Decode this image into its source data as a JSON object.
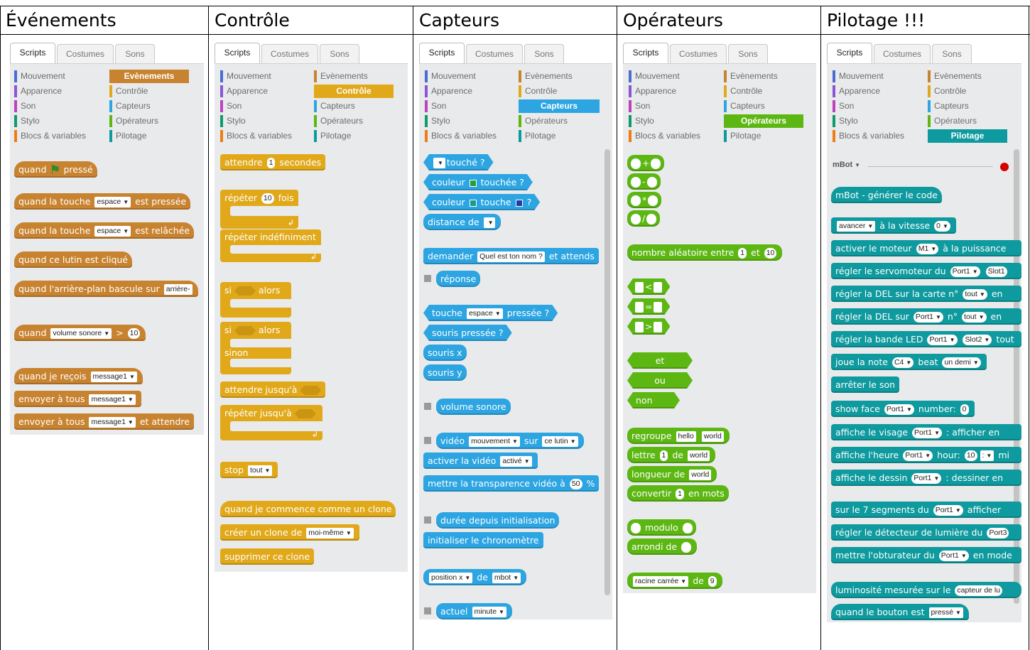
{
  "columns": [
    {
      "title": "Événements"
    },
    {
      "title": "Contrôle"
    },
    {
      "title": "Capteurs"
    },
    {
      "title": "Opérateurs"
    },
    {
      "title": "Pilotage !!!"
    }
  ],
  "tabs": [
    "Scripts",
    "Costumes",
    "Sons"
  ],
  "categories_left": [
    "Mouvement",
    "Apparence",
    "Son",
    "Stylo",
    "Blocs & variables"
  ],
  "categories_right": [
    "Evènements",
    "Contrôle",
    "Capteurs",
    "Opérateurs",
    "Pilotage"
  ],
  "colors": {
    "mouvement": "#4a6cd4",
    "apparence": "#8a55d7",
    "son": "#bb42c3",
    "stylo": "#0e9a6c",
    "blocs": "#ee7d16",
    "evenements": "#c88330",
    "controle": "#e1a91a",
    "capteurs": "#2ca5e2",
    "operateurs": "#5cb712",
    "pilotage": "#0e9a9e"
  },
  "events": {
    "b1a": "quand",
    "b1b": "pressé",
    "b2a": "quand la touche",
    "b2in": "espace",
    "b2b": "est pressée",
    "b3a": "quand la touche",
    "b3in": "espace",
    "b3b": "est relâchée",
    "b4": "quand ce lutin est cliqué",
    "b5a": "quand l'arrière-plan bascule sur",
    "b5in": "arrière-",
    "b6a": "quand",
    "b6in": "volume sonore",
    "b6b": ">",
    "b6v": "10",
    "b7a": "quand je reçois",
    "b7in": "message1",
    "b8a": "envoyer à tous",
    "b8in": "message1",
    "b9a": "envoyer à tous",
    "b9in": "message1",
    "b9b": "et attendre"
  },
  "control": {
    "b1a": "attendre",
    "b1v": "1",
    "b1b": "secondes",
    "b2a": "répéter",
    "b2v": "10",
    "b2b": "fois",
    "b3": "répéter indéfiniment",
    "b4a": "si",
    "b4b": "alors",
    "b5a": "si",
    "b5b": "alors",
    "b5c": "sinon",
    "b6": "attendre jusqu'à",
    "b7": "répéter jusqu'à",
    "b8a": "stop",
    "b8in": "tout",
    "b9": "quand je commence comme un clone",
    "b10a": "créer un clone de",
    "b10in": "moi-même",
    "b11": "supprimer ce clone"
  },
  "sensing": {
    "b1": "touché ?",
    "b2a": "couleur",
    "b2b": "touchée ?",
    "b3a": "couleur",
    "b3b": "touche",
    "b3c": "?",
    "b4": "distance de",
    "b5a": "demander",
    "b5in": "Quel est ton nom ?",
    "b5b": "et attends",
    "b6": "réponse",
    "b7a": "touche",
    "b7in": "espace",
    "b7b": "pressée ?",
    "b8": "souris pressée ?",
    "b9": "souris x",
    "b10": "souris y",
    "b11": "volume sonore",
    "b12a": "vidéo",
    "b12in": "mouvement",
    "b12b": "sur",
    "b12in2": "ce lutin",
    "b13a": "activer la vidéo",
    "b13in": "activé",
    "b14a": "mettre la transparence vidéo à",
    "b14v": "50",
    "b14b": "%",
    "b15": "durée depuis initialisation",
    "b16": "initialiser le chronomètre",
    "b17in": "position x",
    "b17a": "de",
    "b17in2": "mbot",
    "b18a": "actuel",
    "b18in": "minute"
  },
  "operators": {
    "o1": "+",
    "o2": "-",
    "o3": "*",
    "o4": "/",
    "b5a": "nombre aléatoire entre",
    "b5v1": "1",
    "b5b": "et",
    "b5v2": "10",
    "c1": "<",
    "c2": "=",
    "c3": ">",
    "l1": "et",
    "l2": "ou",
    "l3": "non",
    "s1a": "regroupe",
    "s1in": "hello",
    "s1in2": "world",
    "s2a": "lettre",
    "s2v": "1",
    "s2b": "de",
    "s2in": "world",
    "s3a": "longueur de",
    "s3in": "world",
    "s4a": "convertir",
    "s4v": "1",
    "s4b": "en mots",
    "m1": "modulo",
    "m2": "arrondi de",
    "m3in": "racine carrée",
    "m3a": "de",
    "m3v": "9"
  },
  "robot": {
    "header": "mBot",
    "b1": "mBot - générer le code",
    "b2in": "avancer",
    "b2a": "à la vitesse",
    "b2v": "0",
    "b3a": "activer le moteur",
    "b3in": "M1",
    "b3b": "à la puissance",
    "b4a": "régler le servomoteur du",
    "b4in": "Port1",
    "b4in2": "Slot1",
    "b5a": "régler la DEL sur la carte n°",
    "b5in": "tout",
    "b5b": "en",
    "b6a": "régler la DEL sur",
    "b6in": "Port1",
    "b6b": "n°",
    "b6in2": "tout",
    "b6c": "en",
    "b7a": "régler la bande LED",
    "b7in": "Port1",
    "b7in2": "Slot2",
    "b7b": "tout",
    "b8a": "joue la note",
    "b8in": "C4",
    "b8b": "beat",
    "b8in2": "un demi",
    "b9": "arrêter le son",
    "b10a": "show face",
    "b10in": "Port1",
    "b10b": "number:",
    "b10v": "0",
    "b11a": "affiche le visage",
    "b11in": "Port1",
    "b11b": ": afficher en",
    "b12a": "affiche l'heure",
    "b12in": "Port1",
    "b12b": "hour:",
    "b12v": "10",
    "b12c": ":",
    "b12d": "mi",
    "b13a": "affiche le dessin",
    "b13in": "Port1",
    "b13b": ": dessiner en",
    "b14a": "sur le 7 segments du",
    "b14in": "Port1",
    "b14b": "afficher",
    "b15a": "régler le détecteur de lumière du",
    "b15in": "Port3",
    "b16a": "mettre l'obturateur du",
    "b16in": "Port1",
    "b16b": "en mode",
    "b17a": "luminosité mesurée sur le",
    "b17in": "capteur de lu",
    "b18a": "quand le bouton est",
    "b18in": "pressé"
  }
}
